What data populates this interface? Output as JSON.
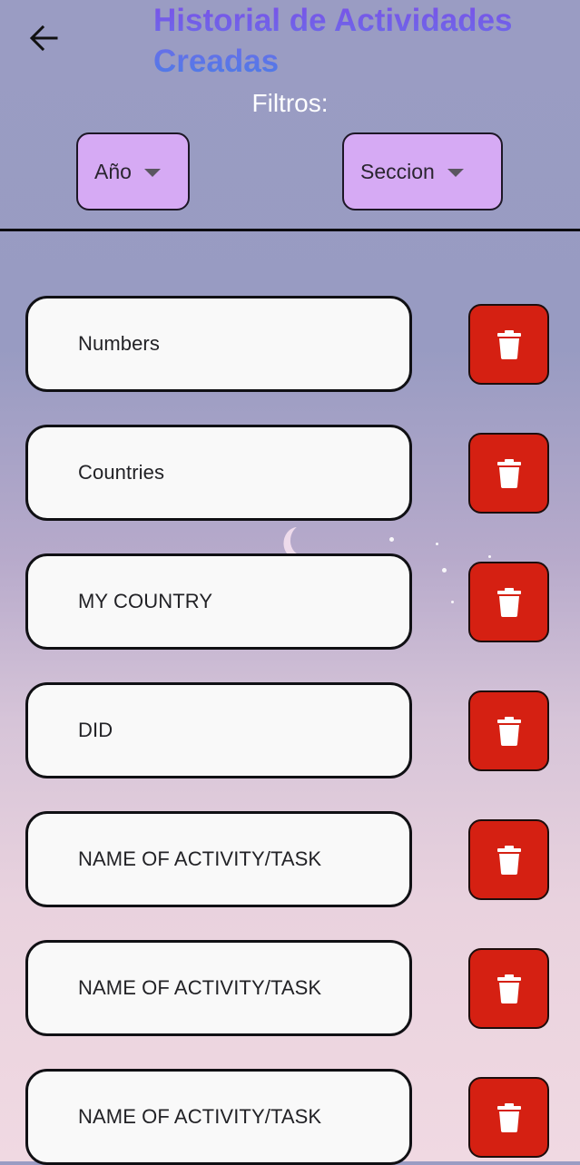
{
  "header": {
    "title": "Historial de Actividades Creadas",
    "back_icon": "arrow-left-icon"
  },
  "filters": {
    "label": "Filtros:",
    "year_dropdown": {
      "value": "Año",
      "icon": "caret-down-icon"
    },
    "section_dropdown": {
      "value": "Seccion",
      "icon": "caret-down-icon"
    }
  },
  "activities": [
    {
      "name": "Numbers"
    },
    {
      "name": "Countries"
    },
    {
      "name": "MY COUNTRY"
    },
    {
      "name": "DID"
    },
    {
      "name": "NAME OF ACTIVITY/TASK"
    },
    {
      "name": "NAME OF ACTIVITY/TASK"
    },
    {
      "name": "NAME OF ACTIVITY/TASK"
    }
  ],
  "delete_icon": "trash-icon",
  "colors": {
    "title_gradient_start": "#7b4fe8",
    "title_gradient_end": "#4a7de6",
    "dropdown_bg": "#d6aaf4",
    "delete_button": "#d52012",
    "card_bg": "#f9f9f9"
  }
}
